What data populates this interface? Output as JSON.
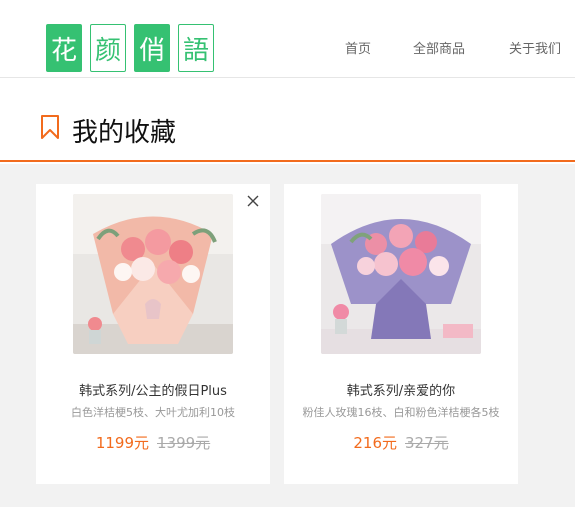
{
  "brand": {
    "logo_chars": [
      "花",
      "颜",
      "俏",
      "語"
    ]
  },
  "nav": {
    "items": [
      "首页",
      "全部商品",
      "关于我们"
    ]
  },
  "page": {
    "title": "我的收藏"
  },
  "colors": {
    "accent": "#f26b1d",
    "brand_green": "#35c172",
    "content_bg": "#f2f2f2"
  },
  "favorites": [
    {
      "name": "韩式系列/公主的假日Plus",
      "desc": "白色洋桔梗5枝、大叶尤加利10枝",
      "price": "1199元",
      "old_price": "1399元",
      "image": "pink-rose-bouquet-pink-wrap"
    },
    {
      "name": "韩式系列/亲爱的你",
      "desc": "粉佳人玫瑰16枝、白和粉色洋桔梗各5枝",
      "price": "216元",
      "old_price": "327元",
      "image": "pink-rose-bouquet-purple-wrap"
    }
  ]
}
